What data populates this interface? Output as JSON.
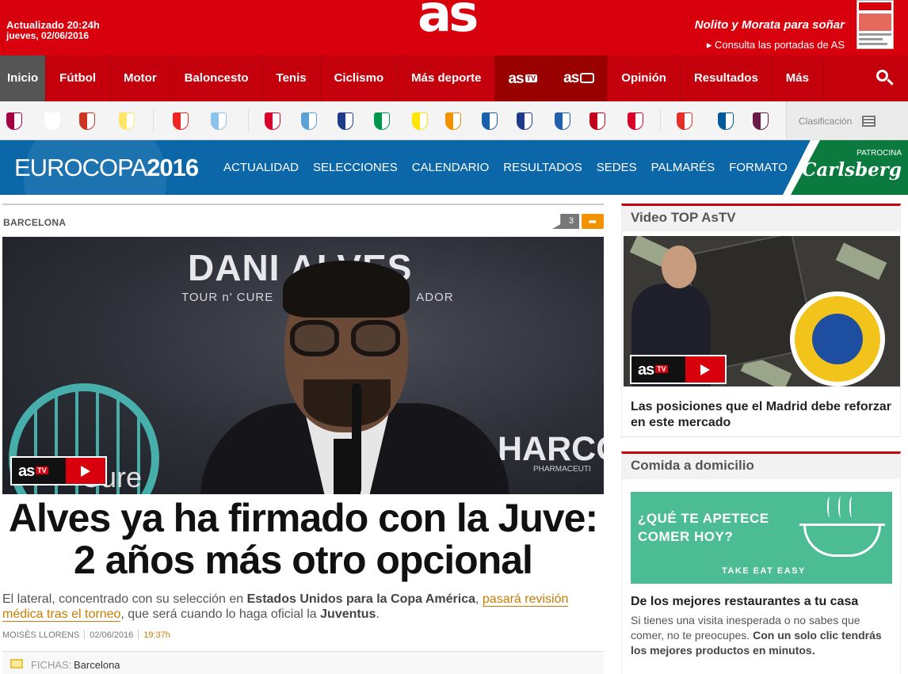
{
  "header": {
    "updated": "Actualizado 20:24h",
    "date": "jueves, 02/06/2016",
    "logo": "as",
    "promo": "Nolito y Morata para soñar",
    "portadas_link": "▸ Consulta las portadas de AS"
  },
  "nav": {
    "items": [
      {
        "label": "Inicio"
      },
      {
        "label": "Fútbol"
      },
      {
        "label": "Motor"
      },
      {
        "label": "Baloncesto"
      },
      {
        "label": "Tenis"
      },
      {
        "label": "Ciclismo"
      },
      {
        "label": "Más deporte"
      },
      {
        "label": "as",
        "sub": "TV"
      },
      {
        "label": "as"
      },
      {
        "label": "Opinión"
      },
      {
        "label": "Resultados"
      },
      {
        "label": "Más"
      }
    ]
  },
  "teams": {
    "crests": [
      "barcelona-crest",
      "real-madrid-crest",
      "atletico-crest",
      "villarreal-crest",
      "athletic-crest",
      "celta-crest",
      "sevilla-crest",
      "malaga-crest",
      "real-sociedad-crest",
      "betis-crest",
      "las-palmas-crest",
      "valencia-crest",
      "espanyol-crest",
      "eibar-crest",
      "deportivo-crest",
      "granada-crest",
      "sporting-crest",
      "rayo-crest",
      "getafe-crest",
      "levante-crest"
    ],
    "colors": [
      "#a50044",
      "#ffffff",
      "#cb3524",
      "#ffe667",
      "#ee2523",
      "#8ac3ee",
      "#d8002a",
      "#5ca1d6",
      "#1d3c8a",
      "#00954c",
      "#ffe400",
      "#f39200",
      "#1a5fac",
      "#1f3c8a",
      "#1f5fac",
      "#c2001c",
      "#d8002a",
      "#e53027",
      "#005999",
      "#6a1a4a"
    ],
    "clasificacion": "Clasificación"
  },
  "euro": {
    "title_light": "EUROCOPA",
    "title_bold": "2016",
    "links": [
      "ACTUALIDAD",
      "SELECCIONES",
      "CALENDARIO",
      "RESULTADOS",
      "SEDES",
      "PALMARÉS",
      "FORMATO"
    ],
    "sponsor_label": "PATROCINA",
    "sponsor": "Carlsberg"
  },
  "article": {
    "section": "BARCELONA",
    "comments": "3",
    "photo_text_1": "DANI ALVES",
    "photo_text_2": "TOUR n' CURE",
    "photo_text_3": "ADOR",
    "photo_text_4": "Cure",
    "photo_text_5": "HARCO",
    "photo_text_6": "PHARMACEUTI",
    "headline": "Alves ya ha firmado con la Juve: 2 años más otro opcional",
    "lead_1": "El lateral, concentrado con su selección en ",
    "lead_b1": "Estados Unidos para la Copa América",
    "lead_2": ", ",
    "lead_link": "pasará revisión médica tras el torneo",
    "lead_3": ", que será cuando lo haga oficial la ",
    "lead_b2": "Juventus",
    "lead_4": ".",
    "author": "MOISÉS LLORENS",
    "date": "02/06/2016",
    "time": "19:37h",
    "fichas_label": "FICHAS:",
    "fichas_value": "Barcelona"
  },
  "astv": {
    "brand": "as",
    "tv": "TV"
  },
  "sidebar": {
    "video_title": "Video TOP AsTV",
    "video_caption": "Las posiciones que el Madrid debe reforzar en este mercado",
    "food_title": "Comida a domicilio",
    "ad_text": "¿QUÉ TE APETECE COMER HOY?",
    "ad_brand": "TAKE EAT EASY",
    "food_headline": "De los mejores restaurantes a tu casa",
    "food_text_1": "Si tienes una visita inesperada o no sabes que comer, no te preocupes. ",
    "food_text_b": "Con un solo clic tendrás los mejores productos en minutos."
  }
}
